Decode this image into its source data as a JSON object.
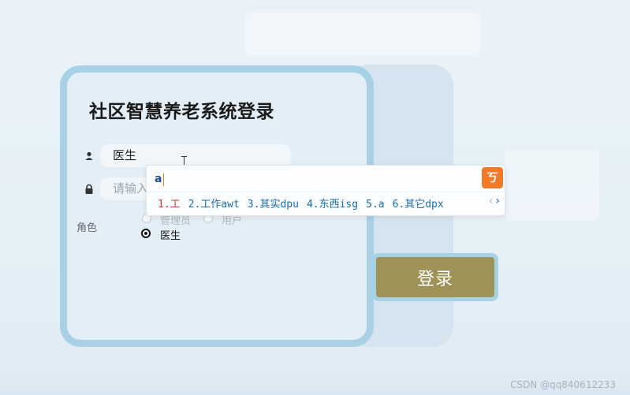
{
  "login": {
    "title": "社区智慧养老系统登录",
    "username_value": "医生",
    "password_placeholder": "请输入",
    "role_label": "角色",
    "roles": [
      {
        "label": "管理员",
        "checked": false
      },
      {
        "label": "用户",
        "checked": false
      },
      {
        "label": "医生",
        "checked": true
      }
    ],
    "submit_label": "登录"
  },
  "ime": {
    "composition": "a",
    "logo": "ㄎ",
    "candidates": [
      "1.工",
      "2.工作awt",
      "3.其实dpu",
      "4.东西isg",
      "5.a",
      "6.其它dpx"
    ],
    "prev": "‹",
    "next": "›"
  },
  "watermark": "CSDN @qq840612233",
  "colors": {
    "card_border": "#a9d1e5",
    "login_button": "#9e9257",
    "ime_logo": "#f07a2a"
  }
}
